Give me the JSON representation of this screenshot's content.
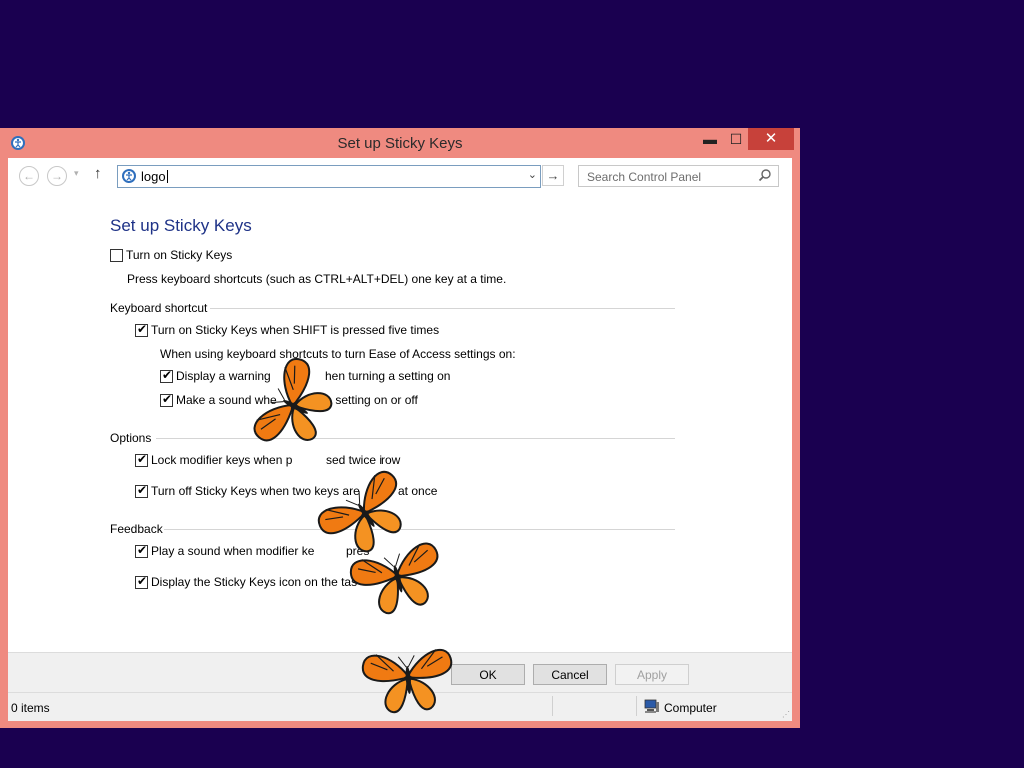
{
  "window": {
    "title": "Set up Sticky Keys",
    "minimize": "▬",
    "maximize": "☐",
    "close": "✕"
  },
  "nav": {
    "back": "←",
    "forward": "→",
    "recent": "▾",
    "up": "↑",
    "address_value": "logo",
    "address_dropdown": "⌄",
    "go": "→",
    "search_placeholder": "Search Control Panel"
  },
  "page": {
    "title": "Set up Sticky Keys",
    "turn_on_label": "Turn on Sticky Keys",
    "turn_on_checked": false,
    "turn_on_desc": "Press keyboard shortcuts (such as CTRL+ALT+DEL) one key at a time.",
    "sections": {
      "keyboard_shortcut": "Keyboard shortcut",
      "options": "Options",
      "feedback": "Feedback"
    },
    "shift_five_label": "Turn on Sticky Keys when SHIFT is pressed five times",
    "shortcut_note": "When using keyboard shortcuts to turn Ease of Access settings on:",
    "warning_label": "Display a warning",
    "warning_tail": "hen turning a setting on",
    "sound_label": "Make a sound whe",
    "sound_tail": "ing a setting on or off",
    "lock_label": "Lock modifier keys when p",
    "lock_mid": "sed twice i",
    "lock_tail": "row",
    "turn_off_label": "Turn off Sticky Keys when two keys are",
    "turn_off_tail": "at once",
    "play_sound_label": "Play a sound when modifier ke",
    "play_sound_tail": "pres",
    "display_icon_label": "Display the Sticky Keys icon on the tas"
  },
  "buttons": {
    "ok": "OK",
    "cancel": "Cancel",
    "apply": "Apply"
  },
  "status": {
    "items": "0 items",
    "location": "Computer",
    "grip": "⋰"
  },
  "colors": {
    "desktop": "#1a0050",
    "window_frame": "#ef8a80",
    "close_button": "#c7413a",
    "title_link": "#1e3287",
    "butterfly_orange": "#f07a12"
  }
}
